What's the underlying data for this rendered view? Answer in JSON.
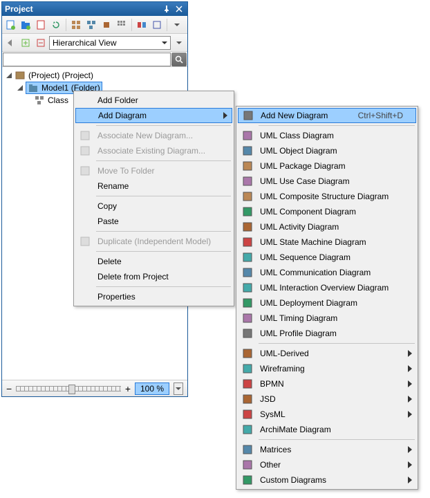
{
  "title_bar": {
    "title": "Project"
  },
  "view_select": {
    "value": "Hierarchical View"
  },
  "search": {
    "placeholder": ""
  },
  "tree": {
    "root_label": "(Project) (Project)",
    "folder_label": "Model1 (Folder)",
    "child_label": "Class"
  },
  "status": {
    "zoom": "100 %",
    "minus": "−",
    "plus": "+"
  },
  "context_menu": {
    "items": [
      {
        "label": "Add Folder"
      },
      {
        "label": "Add Diagram",
        "submenu": true,
        "highlight": true
      },
      {
        "sep": true
      },
      {
        "label": "Associate New Diagram...",
        "disabled": true
      },
      {
        "label": "Associate Existing Diagram...",
        "disabled": true
      },
      {
        "sep": true
      },
      {
        "label": "Move To Folder",
        "disabled": true
      },
      {
        "label": "Rename"
      },
      {
        "sep": true
      },
      {
        "label": "Copy"
      },
      {
        "label": "Paste"
      },
      {
        "sep": true
      },
      {
        "label": "Duplicate (Independent Model)",
        "disabled": true
      },
      {
        "sep": true
      },
      {
        "label": "Delete"
      },
      {
        "label": "Delete from Project"
      },
      {
        "sep": true
      },
      {
        "label": "Properties"
      }
    ]
  },
  "submenu": {
    "items": [
      {
        "label": "Add New Diagram",
        "shortcut": "Ctrl+Shift+D",
        "highlight": true
      },
      {
        "sep": true
      },
      {
        "label": "UML Class Diagram"
      },
      {
        "label": "UML Object Diagram"
      },
      {
        "label": "UML Package Diagram"
      },
      {
        "label": "UML Use Case Diagram"
      },
      {
        "label": "UML Composite Structure Diagram"
      },
      {
        "label": "UML Component Diagram"
      },
      {
        "label": "UML Activity Diagram"
      },
      {
        "label": "UML State Machine Diagram"
      },
      {
        "label": "UML Sequence Diagram"
      },
      {
        "label": "UML Communication Diagram"
      },
      {
        "label": "UML Interaction Overview Diagram"
      },
      {
        "label": "UML Deployment Diagram"
      },
      {
        "label": "UML Timing Diagram"
      },
      {
        "label": "UML Profile Diagram"
      },
      {
        "sep": true
      },
      {
        "label": "UML-Derived",
        "submenu": true
      },
      {
        "label": "Wireframing",
        "submenu": true
      },
      {
        "label": "BPMN",
        "submenu": true
      },
      {
        "label": "JSD",
        "submenu": true
      },
      {
        "label": "SysML",
        "submenu": true
      },
      {
        "label": "ArchiMate Diagram"
      },
      {
        "sep": true
      },
      {
        "label": "Matrices",
        "submenu": true
      },
      {
        "label": "Other",
        "submenu": true
      },
      {
        "label": "Custom Diagrams",
        "submenu": true
      }
    ]
  }
}
